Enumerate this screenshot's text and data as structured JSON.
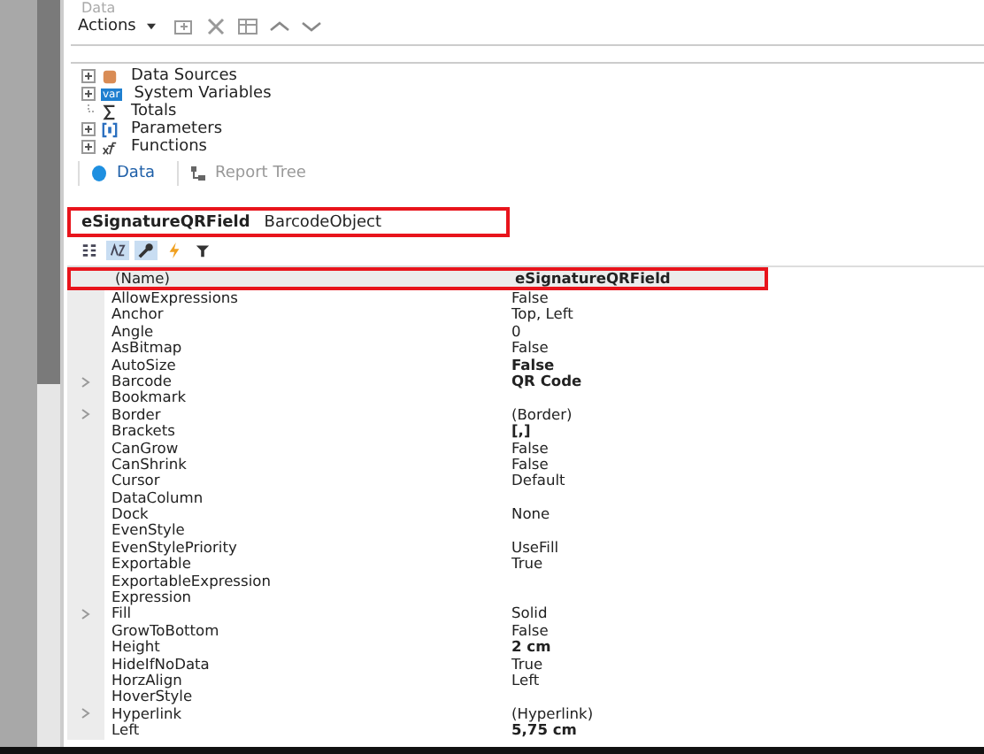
{
  "data_panel": {
    "title": "Data",
    "toolbar": {
      "actions_label": "Actions"
    },
    "tree": [
      {
        "label": "Data Sources",
        "expandable": true
      },
      {
        "label": "System Variables",
        "icon_text": "var",
        "expandable": true
      },
      {
        "label": "Totals",
        "expandable": false
      },
      {
        "label": "Parameters",
        "expandable": true
      },
      {
        "label": "Functions",
        "expandable": true
      }
    ],
    "tabs": [
      {
        "label": "Data",
        "selected": true
      },
      {
        "label": "Report Tree",
        "selected": false
      }
    ]
  },
  "properties_panel": {
    "object": {
      "name": "eSignatureQRField",
      "type": "BarcodeObject",
      "highlighted": true
    },
    "toolbar": [
      {
        "kind": "categorized",
        "selected": false
      },
      {
        "kind": "alphabetical",
        "selected": true
      },
      {
        "kind": "properties",
        "selected": true
      },
      {
        "kind": "events",
        "selected": false
      },
      {
        "kind": "filter",
        "selected": false
      }
    ],
    "rows": [
      {
        "name": "(Name)",
        "value": "eSignatureQRField",
        "bold": true,
        "expandable": false,
        "highlighted": true
      },
      {
        "name": "AllowExpressions",
        "value": "False",
        "bold": false,
        "expandable": false,
        "highlighted": false
      },
      {
        "name": "Anchor",
        "value": "Top, Left",
        "bold": false,
        "expandable": false,
        "highlighted": false
      },
      {
        "name": "Angle",
        "value": "0",
        "bold": false,
        "expandable": false,
        "highlighted": false
      },
      {
        "name": "AsBitmap",
        "value": "False",
        "bold": false,
        "expandable": false,
        "highlighted": false
      },
      {
        "name": "AutoSize",
        "value": "False",
        "bold": true,
        "expandable": false,
        "highlighted": false
      },
      {
        "name": "Barcode",
        "value": "QR Code",
        "bold": true,
        "expandable": true,
        "highlighted": false
      },
      {
        "name": "Bookmark",
        "value": "",
        "expandable": false,
        "highlighted": false
      },
      {
        "name": "Border",
        "value": "(Border)",
        "bold": false,
        "expandable": true,
        "highlighted": false
      },
      {
        "name": "Brackets",
        "value": "[,]",
        "bold": true,
        "expandable": false,
        "highlighted": false
      },
      {
        "name": "CanGrow",
        "value": "False",
        "bold": false,
        "expandable": false,
        "highlighted": false
      },
      {
        "name": "CanShrink",
        "value": "False",
        "bold": false,
        "expandable": false,
        "highlighted": false
      },
      {
        "name": "Cursor",
        "value": "Default",
        "bold": false,
        "expandable": false,
        "highlighted": false
      },
      {
        "name": "DataColumn",
        "value": "",
        "expandable": false,
        "highlighted": false
      },
      {
        "name": "Dock",
        "value": "None",
        "bold": false,
        "expandable": false,
        "highlighted": false
      },
      {
        "name": "EvenStyle",
        "value": "",
        "expandable": false,
        "highlighted": false
      },
      {
        "name": "EvenStylePriority",
        "value": "UseFill",
        "bold": false,
        "expandable": false,
        "highlighted": false
      },
      {
        "name": "Exportable",
        "value": "True",
        "bold": false,
        "expandable": false,
        "highlighted": false
      },
      {
        "name": "ExportableExpression",
        "value": "",
        "expandable": false,
        "highlighted": false
      },
      {
        "name": "Expression",
        "value": "",
        "expandable": false,
        "highlighted": false
      },
      {
        "name": "Fill",
        "value": "Solid",
        "bold": false,
        "expandable": true,
        "highlighted": false
      },
      {
        "name": "GrowToBottom",
        "value": "False",
        "bold": false,
        "expandable": false,
        "highlighted": false
      },
      {
        "name": "Height",
        "value": "2 cm",
        "bold": true,
        "expandable": false,
        "highlighted": false
      },
      {
        "name": "HideIfNoData",
        "value": "True",
        "bold": false,
        "expandable": false,
        "highlighted": false
      },
      {
        "name": "HorzAlign",
        "value": "Left",
        "bold": false,
        "expandable": false,
        "highlighted": false
      },
      {
        "name": "HoverStyle",
        "value": "",
        "expandable": false,
        "highlighted": false
      },
      {
        "name": "Hyperlink",
        "value": "(Hyperlink)",
        "bold": false,
        "expandable": true,
        "highlighted": false
      },
      {
        "name": "Left",
        "value": "5,75 cm",
        "bold": true,
        "expandable": false,
        "highlighted": false
      }
    ]
  }
}
